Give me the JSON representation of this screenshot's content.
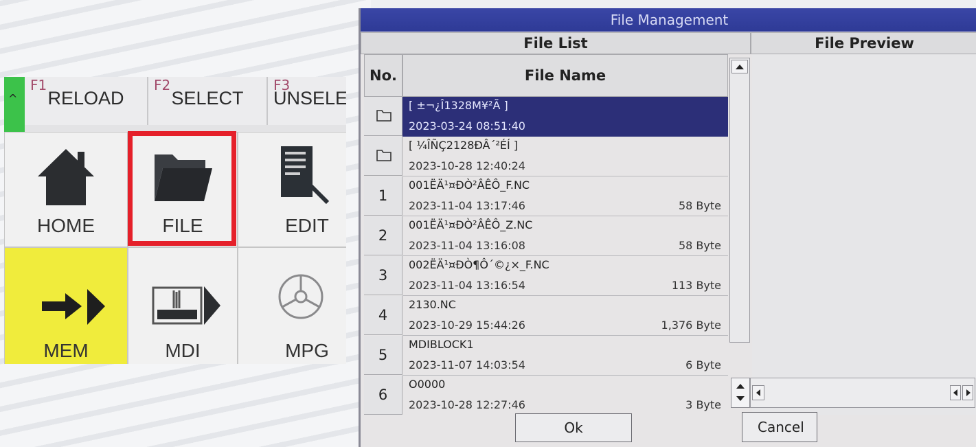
{
  "function_keys": [
    {
      "number": "F1",
      "label": "RELOAD"
    },
    {
      "number": "F2",
      "label": "SELECT"
    },
    {
      "number": "F3",
      "label": "UNSELE"
    }
  ],
  "fkey_edge_glyph": "^",
  "mode_tiles": [
    {
      "label": "HOME",
      "icon": "home-icon"
    },
    {
      "label": "FILE",
      "icon": "folder-icon",
      "highlighted": true
    },
    {
      "label": "EDIT",
      "icon": "edit-document-icon"
    },
    {
      "label": "MEM",
      "icon": "arrow-right-icon",
      "active": true
    },
    {
      "label": "MDI",
      "icon": "hand-arrow-icon"
    },
    {
      "label": "MPG",
      "icon": "handwheel-icon"
    }
  ],
  "colors": {
    "highlight_box": "#e5202a",
    "mem_tile": "#f0ec3c",
    "title_bar": "#2e3a96",
    "selected_row": "#2c2f78",
    "fkey_edge": "#3cc24a"
  },
  "dialog": {
    "title": "File Management",
    "file_list_header": "File List",
    "file_preview_header": "File Preview",
    "col_no": "No.",
    "col_file_name": "File Name",
    "ok_label": "Ok",
    "cancel_label": "Cancel"
  },
  "files": [
    {
      "no": "",
      "type": "folder",
      "name": "[ ±¬¿Î1328M¥²Ã ]",
      "date": "2023-03-24 08:51:40",
      "size": "",
      "selected": true
    },
    {
      "no": "",
      "type": "folder",
      "name": "[ ¼ÎÑÇ2128ÐÂ´²ÉÍ ]",
      "date": "2023-10-28 12:40:24",
      "size": ""
    },
    {
      "no": "1",
      "type": "file",
      "name": "001ËÄ¹¤ÐÒ²ÂÊÔ_F.NC",
      "date": "2023-11-04 13:17:46",
      "size": "58 Byte"
    },
    {
      "no": "2",
      "type": "file",
      "name": "001ËÄ¹¤ÐÒ²ÂÊÔ_Z.NC",
      "date": "2023-11-04 13:16:08",
      "size": "58 Byte"
    },
    {
      "no": "3",
      "type": "file",
      "name": "002ËÄ¹¤ÐÒ¶Ô´©¿×_F.NC",
      "date": "2023-11-04 13:16:54",
      "size": "113 Byte"
    },
    {
      "no": "4",
      "type": "file",
      "name": "2130.NC",
      "date": "2023-10-29 15:44:26",
      "size": "1,376 Byte"
    },
    {
      "no": "5",
      "type": "file",
      "name": "MDIBLOCK1",
      "date": "2023-11-07 14:03:54",
      "size": "6 Byte"
    },
    {
      "no": "6",
      "type": "file",
      "name": "O0000",
      "date": "2023-10-28 12:27:46",
      "size": "3 Byte"
    }
  ]
}
